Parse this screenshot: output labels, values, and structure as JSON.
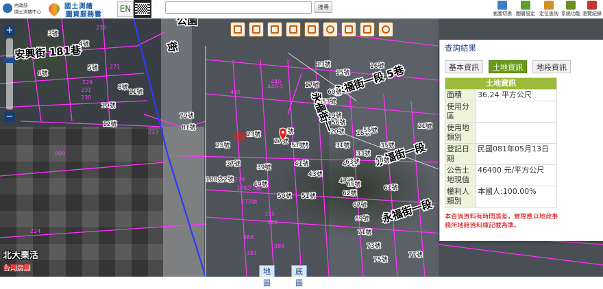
{
  "header": {
    "agency_line1": "內政部",
    "agency_line2": "國土測繪中心",
    "service_line1": "國土測繪",
    "service_line2": "圖資服務雲",
    "lang_button": "EN",
    "search_placeholder": "",
    "search_button": "搜尋",
    "tools": [
      {
        "label": "底圖切換",
        "icon": "basemap-switch-icon",
        "color": "#3c7dc4"
      },
      {
        "label": "圖層設定",
        "icon": "layer-settings-icon",
        "color": "#5aa02c"
      },
      {
        "label": "定位查詢",
        "icon": "locate-query-icon",
        "color": "#d2902a"
      },
      {
        "label": "系統功能",
        "icon": "system-function-icon",
        "color": "#6b8e23"
      },
      {
        "label": "瀏覽紀錄",
        "icon": "browse-history-icon",
        "color": "#c0392b"
      }
    ]
  },
  "map": {
    "labels": {
      "street_181": "安興街 181巷",
      "yongfu_5": "永福街一段 5巷",
      "yongfu_a": "永福街一段",
      "yongfu_b": "永福街一段",
      "yongfu_side": "永福街一",
      "jie": "街",
      "park_hint": "公園"
    },
    "lot_numbers": [
      "233",
      "271",
      "229",
      "231",
      "230",
      "223",
      "224",
      "909",
      "440",
      "440-2",
      "445",
      "3號",
      "4號",
      "5號",
      "6號",
      "8號",
      "10號",
      "11號",
      "12號",
      "13號",
      "15號",
      "16號",
      "17號",
      "18號",
      "19號",
      "20號",
      "21號",
      "23號",
      "25號",
      "27號",
      "29號",
      "31號",
      "33號",
      "35號",
      "37號",
      "39號",
      "41號",
      "43號",
      "45號",
      "47號",
      "49號",
      "50號",
      "51號",
      "52號",
      "53號",
      "55號",
      "56號",
      "57號",
      "58號",
      "60號",
      "61號",
      "62號",
      "63號",
      "65號",
      "67號",
      "69號",
      "71號",
      "73號",
      "75號",
      "77號",
      "79號",
      "81號",
      "180之2號",
      "178之1號",
      "172號",
      "388",
      "386",
      "335",
      "389",
      "381",
      "379",
      "355",
      "336",
      "388"
    ]
  },
  "map_tools": [
    "select-arrow-icon",
    "3d-building-icon",
    "route-a-icon",
    "route-b-icon",
    "hand-pan-icon",
    "measure-point-icon",
    "measure-line-icon",
    "measure-area-icon",
    "pin-tool-icon"
  ],
  "basemap_buttons": {
    "map": "地圖",
    "base": "底圖"
  },
  "panel": {
    "title": "查詢結果",
    "tabs": [
      "基本資訊",
      "土地資訊",
      "地段資訊"
    ],
    "active_tab": 1,
    "table_header": "土地資訊",
    "rows": [
      {
        "k": "面積",
        "v": "36.24 平方公尺"
      },
      {
        "k": "使用分區",
        "v": ""
      },
      {
        "k": "使用地類別",
        "v": ""
      },
      {
        "k": "登記日期",
        "v": "民國081年05月13日"
      },
      {
        "k": "公告土地現值",
        "v": "46400 元/平方公尺"
      },
      {
        "k": "權利人類別",
        "v": "本國人:100.00%"
      }
    ],
    "note": "本查詢資料有時間落差，實際應以地政事務所地籍資料庫記載為準。"
  },
  "watermark": {
    "line1": "北大栗活",
    "line2": "台灣房屋"
  }
}
